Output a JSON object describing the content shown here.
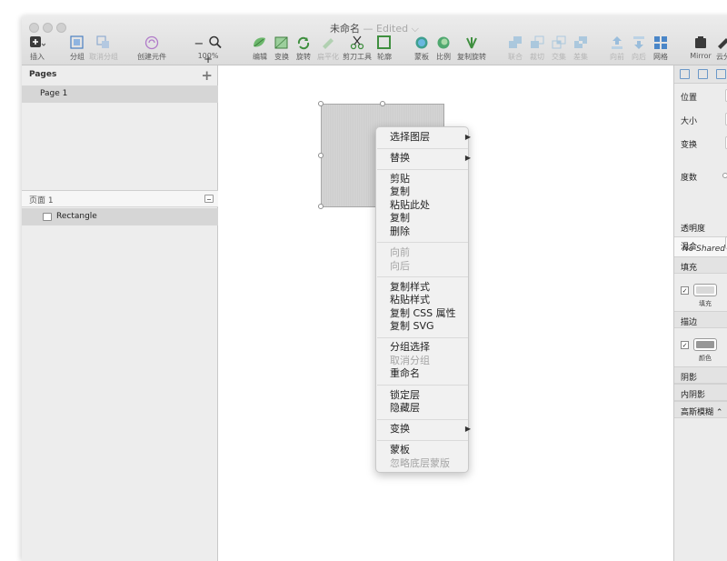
{
  "window": {
    "title": "未命名",
    "title_status": "— Edited ⌵"
  },
  "toolbar": {
    "insert": "插入",
    "group": "分组",
    "ungroup": "取消分组",
    "create_symbol": "创建元件",
    "zoom": "100%",
    "zoom_minus": "−",
    "zoom_plus": "+",
    "edit": "编辑",
    "transform": "变换",
    "rotate": "旋转",
    "flatten": "扁平化",
    "scissors": "剪刀工具",
    "outline": "轮廓",
    "mask": "蒙板",
    "scale": "比例",
    "rotate_copies": "复制旋转",
    "union": "联合",
    "subtract": "裁切",
    "intersect": "交集",
    "difference": "差集",
    "forward": "向前",
    "backward": "向后",
    "grid": "网格",
    "mirror": "Mirror",
    "cloud": "云分"
  },
  "left_panel": {
    "pages_header": "Pages",
    "page_name": "Page 1",
    "layers_header": "页面 1",
    "layer_name": "Rectangle"
  },
  "context_menu": {
    "select_layer": "选择图层",
    "replace": "替换",
    "cut": "剪贴",
    "copy": "复制",
    "paste_here": "粘贴此处",
    "duplicate": "复制",
    "delete": "删除",
    "bring_forward": "向前",
    "send_backward": "向后",
    "copy_style": "复制样式",
    "paste_style": "粘贴样式",
    "copy_css": "复制 CSS 属性",
    "copy_svg": "复制 SVG",
    "group_selection": "分组选择",
    "ungroup": "取消分组",
    "rename": "重命名",
    "lock_layer": "锁定层",
    "hide_layer": "隐藏层",
    "transform": "变换",
    "mask": "蒙板",
    "ignore_mask": "忽略底层蒙版"
  },
  "inspector": {
    "position": "位置",
    "size": "大小",
    "transform": "变换",
    "rotation": "度数",
    "shared_style": "No Shared Style",
    "opacity": "透明度",
    "blending": "混合",
    "fills": "填充",
    "fill_caption": "填充",
    "borders": "描边",
    "border_caption": "颜色",
    "shadows": "阴影",
    "inner_shadows": "内阴影",
    "blur": "高斯模糊 ⌃"
  },
  "colors": {
    "fill_swatch": "#d8d8d8",
    "border_swatch": "#979797",
    "accent": "#6b98c8"
  }
}
